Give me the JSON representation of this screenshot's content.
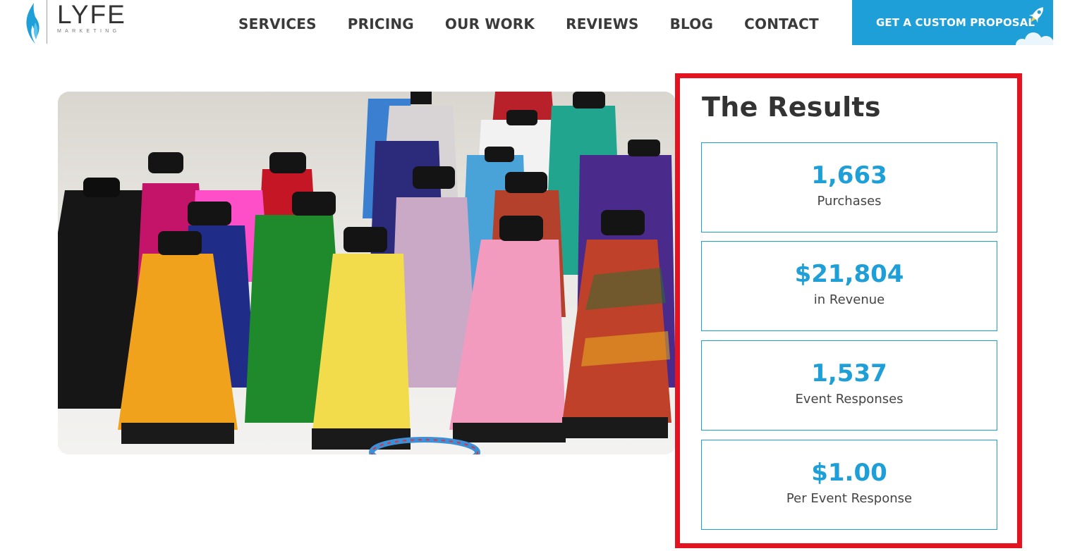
{
  "logo": {
    "wordmark": "LYFE",
    "tagline": "MARKETING",
    "icon": "flame-icon"
  },
  "nav": {
    "items": [
      {
        "label": "SERVICES"
      },
      {
        "label": "PRICING"
      },
      {
        "label": "OUR WORK"
      },
      {
        "label": "REVIEWS"
      },
      {
        "label": "BLOG"
      },
      {
        "label": "CONTACT"
      }
    ]
  },
  "cta": {
    "label": "GET A CUSTOM PROPOSAL",
    "icon": "rocket-icon"
  },
  "hero": {
    "image": "colorful-yarn-spools-photo"
  },
  "results": {
    "title": "The Results",
    "stats": [
      {
        "value": "1,663",
        "label": "Purchases"
      },
      {
        "value": "$21,804",
        "label": "in Revenue"
      },
      {
        "value": "1,537",
        "label": "Event Responses"
      },
      {
        "value": "$1.00",
        "label": "Per Event Response"
      }
    ]
  },
  "colors": {
    "accent": "#1e9fd8",
    "highlight": "#e3141f",
    "text": "#333333"
  }
}
